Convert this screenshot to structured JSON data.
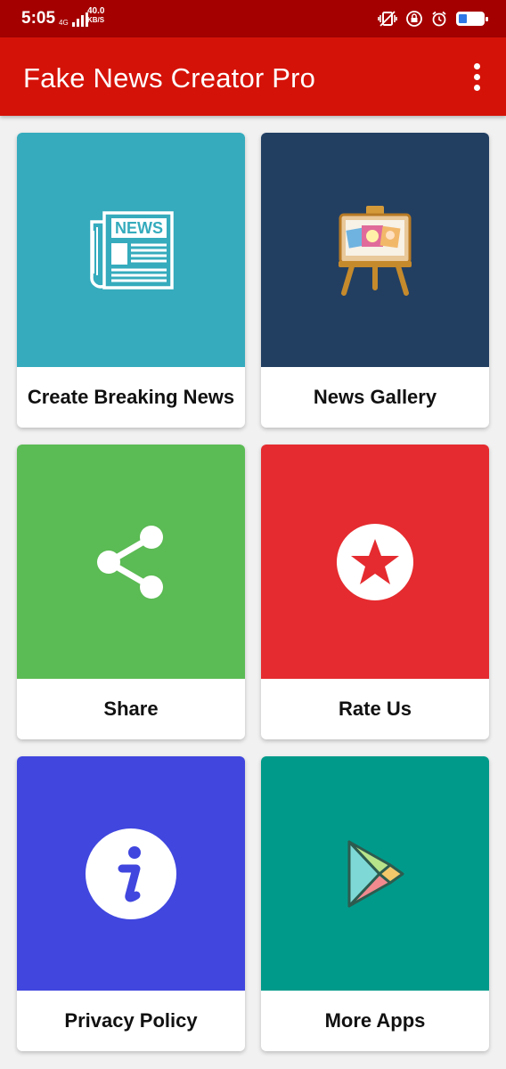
{
  "status_bar": {
    "time": "5:05",
    "network": "4G",
    "speed_value": "40.0",
    "speed_unit": "KB/S"
  },
  "app_bar": {
    "title": "Fake News Creator Pro",
    "menu_icon": "overflow-menu-icon"
  },
  "tiles": [
    {
      "label": "Create Breaking News",
      "color": "#35abbd",
      "icon": "newspaper-icon"
    },
    {
      "label": "News Gallery",
      "color": "#223f62",
      "icon": "gallery-easel-icon"
    },
    {
      "label": "Share",
      "color": "#5bbb54",
      "icon": "share-icon"
    },
    {
      "label": "Rate Us",
      "color": "#e52b2f",
      "icon": "star-icon"
    },
    {
      "label": "Privacy Policy",
      "color": "#4046de",
      "icon": "info-icon"
    },
    {
      "label": "More Apps",
      "color": "#009a8a",
      "icon": "play-store-icon"
    }
  ]
}
